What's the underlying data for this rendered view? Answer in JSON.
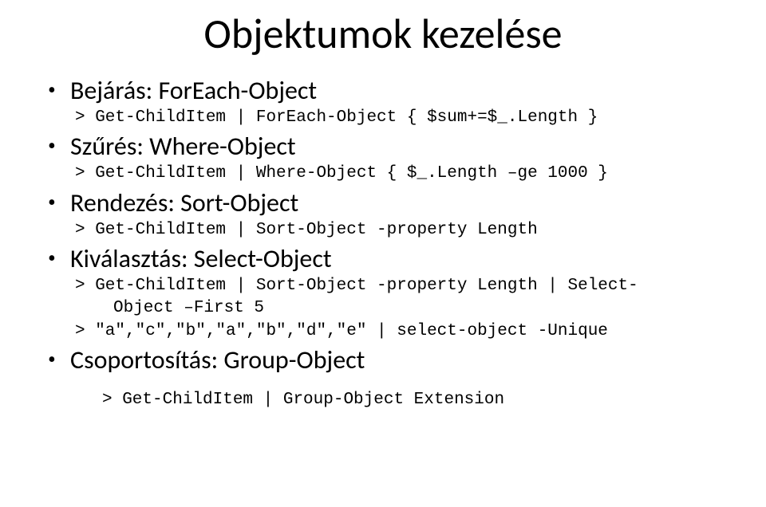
{
  "title": "Objektumok kezelése",
  "sections": [
    {
      "heading": "Bejárás: ForEach-Object",
      "code_prefix": "> Get-ChildItem | ForEach-Object { $sum+=$_.Length }"
    },
    {
      "heading": "Szűrés: Where-Object",
      "code_prefix": "> Get-ChildItem | Where-Object { $_.Length –ge 1000 }"
    },
    {
      "heading": "Rendezés: Sort-Object",
      "code_prefix": "> Get-ChildItem | Sort-Object -property Length"
    },
    {
      "heading": "Kiválasztás: Select-Object",
      "code_prefix": "> Get-ChildItem | Sort-Object -property Length | Select-",
      "code_wrap": "Object –First 5",
      "extra_code": "> \"a\",\"c\",\"b\",\"a\",\"b\",\"d\",\"e\" | select-object -Unique"
    },
    {
      "heading": "Csoportosítás: Group-Object",
      "final_code": "> Get-ChildItem | Group-Object Extension"
    }
  ]
}
